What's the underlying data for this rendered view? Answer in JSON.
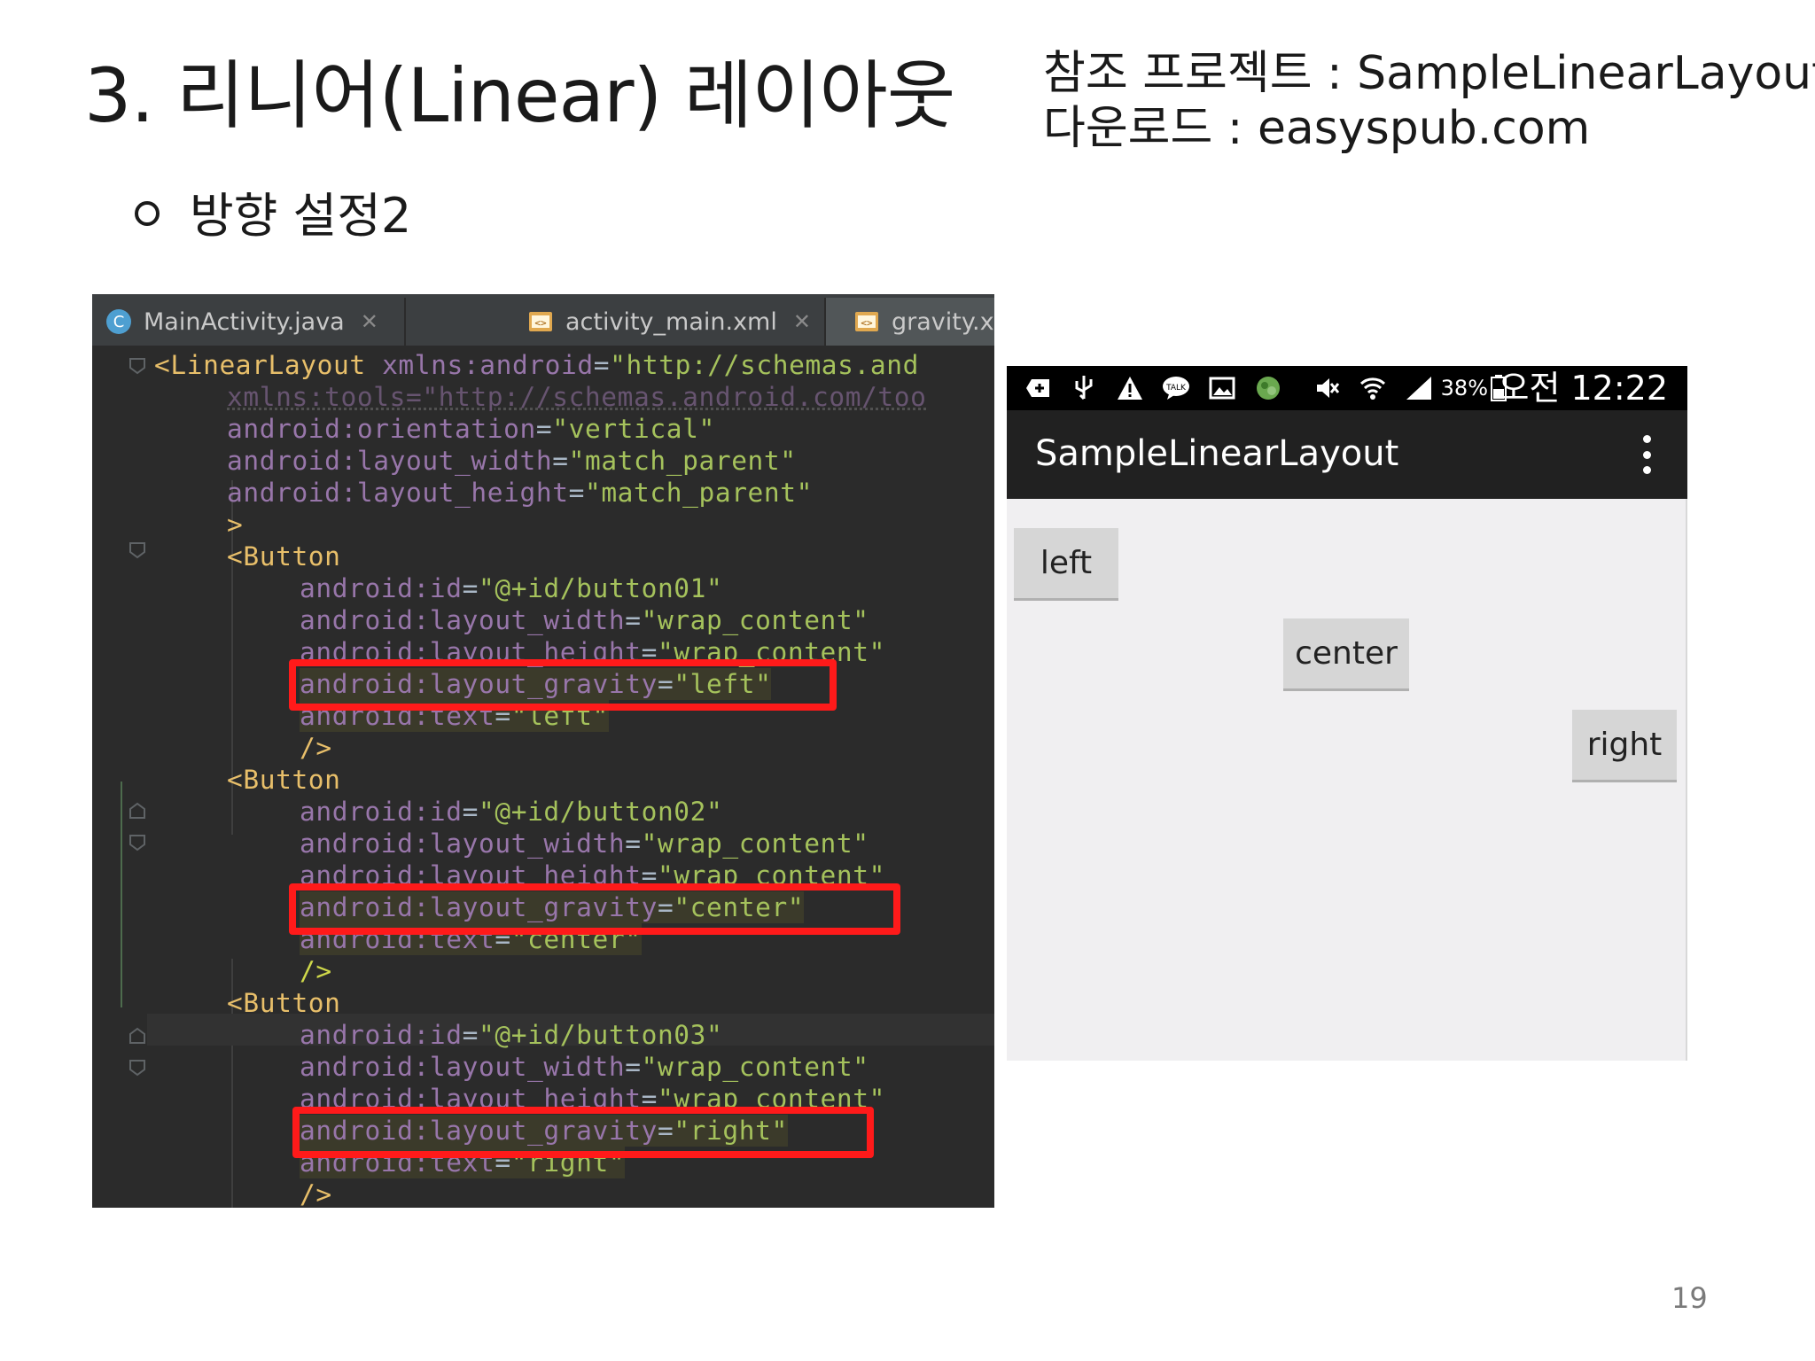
{
  "slide": {
    "title": "3. 리니어(Linear) 레이아웃",
    "ref_project": "참조 프로젝트 : SampleLinearLayout",
    "download": "다운로드 : easyspub.com",
    "subtitle": "방향 설정2",
    "page_number": "19"
  },
  "ide": {
    "tabs": [
      {
        "label": "MainActivity.java",
        "icon": "java-class-icon"
      },
      {
        "label": "activity_main.xml",
        "icon": "xml-layout-icon"
      },
      {
        "label": "gravity.xml",
        "icon": "xml-layout-icon",
        "active": true
      }
    ],
    "code": {
      "l1": {
        "tag": "<LinearLayout",
        "attr": "xmlns:android",
        "val": "\"http://schemas.and"
      },
      "l2": "xmlns:tools=\"http://schemas.android.com/too",
      "l3": {
        "attr": "android:orientation",
        "val": "\"vertical\""
      },
      "l4": {
        "attr": "android:layout_width",
        "val": "\"match_parent\""
      },
      "l5": {
        "attr": "android:layout_height",
        "val": "\"match_parent\""
      },
      "l6": ">",
      "button_tag": "<Button",
      "close_tag": "/>",
      "b1": {
        "id": {
          "attr": "android:id",
          "val": "\"@+id/button01\""
        },
        "width": {
          "attr": "android:layout_width",
          "val": "\"wrap_content\""
        },
        "height": {
          "attr": "android:layout_height",
          "val": "\"wrap_content\""
        },
        "gravity": {
          "attr": "android:layout_gravity",
          "val": "\"left\""
        },
        "text": {
          "attr": "android:text",
          "val": "\"left\""
        }
      },
      "b2": {
        "id": {
          "attr": "android:id",
          "val": "\"@+id/button02\""
        },
        "width": {
          "attr": "android:layout_width",
          "val": "\"wrap_content\""
        },
        "height": {
          "attr": "android:layout_height",
          "val": "\"wrap_content\""
        },
        "gravity": {
          "attr": "android:layout_gravity",
          "val": "\"center\""
        },
        "text": {
          "attr": "android:text",
          "val": "\"center\""
        }
      },
      "b3": {
        "id": {
          "attr": "android:id",
          "val": "\"@+id/button03\""
        },
        "width": {
          "attr": "android:layout_width",
          "val": "\"wrap_content\""
        },
        "height": {
          "attr": "android:layout_height",
          "val": "\"wrap_content\""
        },
        "gravity": {
          "attr": "android:layout_gravity",
          "val": "\"right\""
        },
        "text": {
          "attr": "android:text",
          "val": "\"right\""
        }
      }
    }
  },
  "phone": {
    "status": {
      "battery": "38%",
      "time": "오전 12:22"
    },
    "app_title": "SampleLinearLayout",
    "buttons": {
      "left": "left",
      "center": "center",
      "right": "right"
    }
  },
  "colors": {
    "ide_bg": "#2b2b2b",
    "xml_attr": "#9876aa",
    "xml_tag": "#e8bf6a",
    "xml_value": "#6a8759",
    "highlight_box": "#ff1a1a",
    "action_bar": "#212121"
  }
}
